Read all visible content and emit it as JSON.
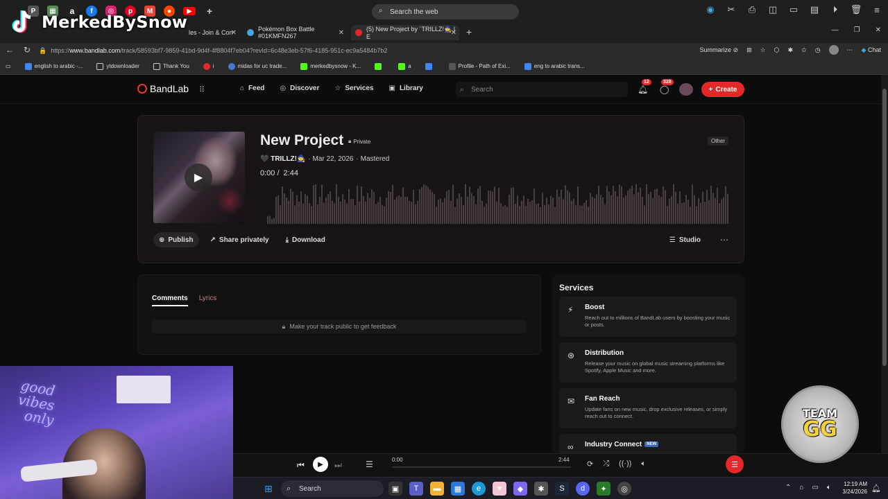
{
  "overlay": {
    "brand": "MerkedBySnow"
  },
  "browser": {
    "search_web_placeholder": "Search the web",
    "tabs": [
      {
        "label": "les - Join & Con"
      },
      {
        "label": "Pokémon Box Battle #01KMFN267"
      },
      {
        "label": "(5) New Project by  ¨TRILLZ!🧙 | E"
      }
    ],
    "url_prefix": "https://",
    "url_host": "www.bandlab.com",
    "url_rest": "/track/58593bf7-9859-41bd-9d4f-4f8804f7eb04?revId=6c48e3eb-57f6-4185-951c-ec9a5484b7b2",
    "summarize_label": "Summarize",
    "chat_label": "Chat",
    "bookmarks": [
      {
        "label": "english to arabic -..."
      },
      {
        "label": "ytdownloader"
      },
      {
        "label": "Thank You"
      },
      {
        "label": "i"
      },
      {
        "label": "midas for uc trade..."
      },
      {
        "label": "merkedbysnow - K..."
      },
      {
        "label": ""
      },
      {
        "label": "a"
      },
      {
        "label": ""
      },
      {
        "label": "Profile - Path of Exi..."
      },
      {
        "label": "eng to arabic trans..."
      }
    ]
  },
  "bandlab": {
    "logo_text": "BandLab",
    "nav": {
      "feed": "Feed",
      "discover": "Discover",
      "services": "Services",
      "library": "Library"
    },
    "search_placeholder": "Search",
    "notif_count": "12",
    "msg_count": "328",
    "create_label": "Create",
    "track": {
      "title": "New Project",
      "privacy": "Private",
      "artist": "🖤 TRILLZ!🧙",
      "date": "· Mar 22, 2026",
      "status": "· Mastered",
      "current_time": "0:00 /",
      "duration": "2:44",
      "genre": "Other",
      "publish_label": "Publish",
      "share_label": "Share privately",
      "download_label": "Download",
      "studio_label": "Studio"
    },
    "comments": {
      "tab_comments": "Comments",
      "tab_lyrics": "Lyrics",
      "feedback_text": "Make your track public to get feedback"
    },
    "services": {
      "title": "Services",
      "items": [
        {
          "name": "Boost",
          "desc": "Reach out to millions of BandLab users by boosting your music or posts."
        },
        {
          "name": "Distribution",
          "desc": "Release your music on global music streaming platforms like Spotify, Apple Music and more."
        },
        {
          "name": "Fan Reach",
          "desc": "Update fans on new music, drop exclusive releases, or simply reach out to connect."
        },
        {
          "name": "Industry Connect",
          "badge": "NEW"
        }
      ]
    },
    "player": {
      "current": "0:00",
      "duration": "2:44"
    }
  },
  "coin": {
    "line1": "TEAM",
    "line2": "GG"
  },
  "taskbar": {
    "search_label": "Search",
    "time": "12:19 AM",
    "date": "3/24/2026"
  },
  "colors": {
    "accent": "#e22828",
    "bg": "#0c0c0c",
    "card": "#191516"
  }
}
